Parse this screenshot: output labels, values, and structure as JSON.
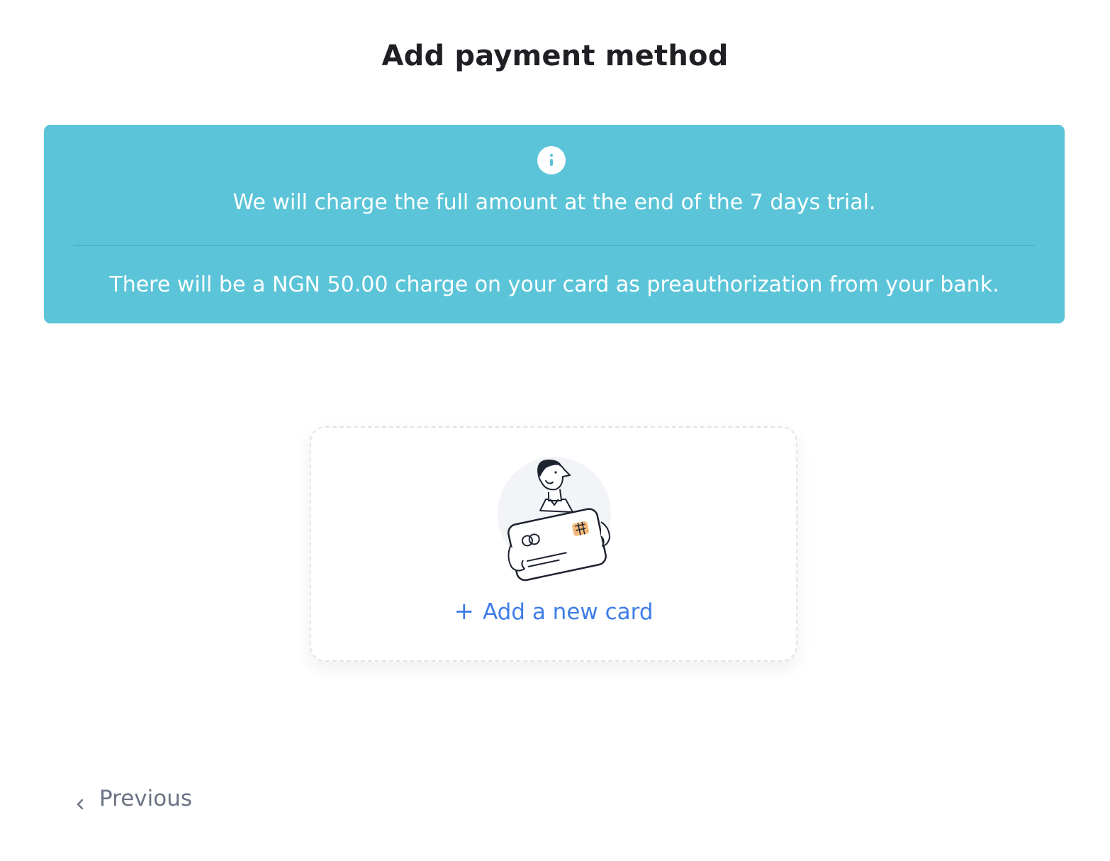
{
  "page": {
    "title": "Add payment method"
  },
  "notice": {
    "icon": "info-icon",
    "trial_message": "We will charge the full amount at the end of the 7 days trial.",
    "preauth_message": "There will be a NGN 50.00 charge on your card as preauthorization from your bank.",
    "background_color": "#5bc4d8"
  },
  "add_card": {
    "icon": "plus-icon",
    "illustration": "person-holding-card-illustration",
    "label": "Add a new card",
    "color": "#3f7de8"
  },
  "navigation": {
    "icon": "chevron-left-icon",
    "previous_label": "Previous"
  }
}
